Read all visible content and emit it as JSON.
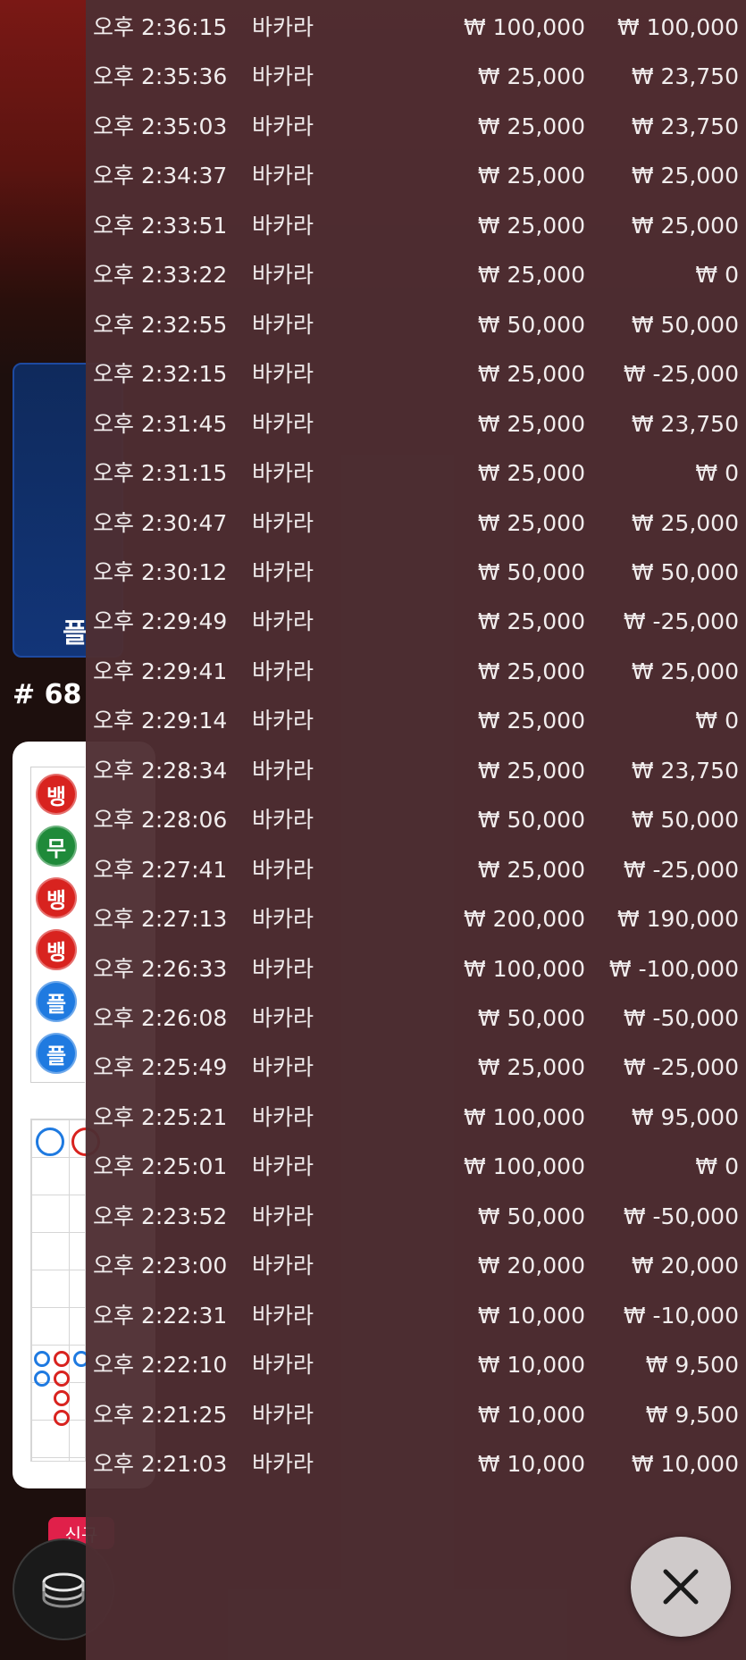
{
  "background": {
    "player_panel_label": "플",
    "round_number": "# 68",
    "bead_road": [
      {
        "label": "뱅",
        "color": "#d8231f"
      },
      {
        "label": "무",
        "color": "#1f8a3a"
      },
      {
        "label": "뱅",
        "color": "#d8231f"
      },
      {
        "label": "뱅",
        "color": "#d8231f"
      },
      {
        "label": "플",
        "color": "#1f7ae0"
      },
      {
        "label": "플",
        "color": "#1f7ae0"
      }
    ],
    "new_badge": "신규"
  },
  "history": {
    "rows": [
      {
        "time": "오후 2:36:15",
        "game": "바카라",
        "bet": "₩ 100,000",
        "payout": "₩ 100,000"
      },
      {
        "time": "오후 2:35:36",
        "game": "바카라",
        "bet": "₩ 25,000",
        "payout": "₩ 23,750"
      },
      {
        "time": "오후 2:35:03",
        "game": "바카라",
        "bet": "₩ 25,000",
        "payout": "₩ 23,750"
      },
      {
        "time": "오후 2:34:37",
        "game": "바카라",
        "bet": "₩ 25,000",
        "payout": "₩ 25,000"
      },
      {
        "time": "오후 2:33:51",
        "game": "바카라",
        "bet": "₩ 25,000",
        "payout": "₩ 25,000"
      },
      {
        "time": "오후 2:33:22",
        "game": "바카라",
        "bet": "₩ 25,000",
        "payout": "₩ 0"
      },
      {
        "time": "오후 2:32:55",
        "game": "바카라",
        "bet": "₩ 50,000",
        "payout": "₩ 50,000"
      },
      {
        "time": "오후 2:32:15",
        "game": "바카라",
        "bet": "₩ 25,000",
        "payout": "₩ -25,000"
      },
      {
        "time": "오후 2:31:45",
        "game": "바카라",
        "bet": "₩ 25,000",
        "payout": "₩ 23,750"
      },
      {
        "time": "오후 2:31:15",
        "game": "바카라",
        "bet": "₩ 25,000",
        "payout": "₩ 0"
      },
      {
        "time": "오후 2:30:47",
        "game": "바카라",
        "bet": "₩ 25,000",
        "payout": "₩ 25,000"
      },
      {
        "time": "오후 2:30:12",
        "game": "바카라",
        "bet": "₩ 50,000",
        "payout": "₩ 50,000"
      },
      {
        "time": "오후 2:29:49",
        "game": "바카라",
        "bet": "₩ 25,000",
        "payout": "₩ -25,000"
      },
      {
        "time": "오후 2:29:41",
        "game": "바카라",
        "bet": "₩ 25,000",
        "payout": "₩ 25,000"
      },
      {
        "time": "오후 2:29:14",
        "game": "바카라",
        "bet": "₩ 25,000",
        "payout": "₩ 0"
      },
      {
        "time": "오후 2:28:34",
        "game": "바카라",
        "bet": "₩ 25,000",
        "payout": "₩ 23,750"
      },
      {
        "time": "오후 2:28:06",
        "game": "바카라",
        "bet": "₩ 50,000",
        "payout": "₩ 50,000"
      },
      {
        "time": "오후 2:27:41",
        "game": "바카라",
        "bet": "₩ 25,000",
        "payout": "₩ -25,000"
      },
      {
        "time": "오후 2:27:13",
        "game": "바카라",
        "bet": "₩ 200,000",
        "payout": "₩ 190,000"
      },
      {
        "time": "오후 2:26:33",
        "game": "바카라",
        "bet": "₩ 100,000",
        "payout": "₩ -100,000"
      },
      {
        "time": "오후 2:26:08",
        "game": "바카라",
        "bet": "₩ 50,000",
        "payout": "₩ -50,000"
      },
      {
        "time": "오후 2:25:49",
        "game": "바카라",
        "bet": "₩ 25,000",
        "payout": "₩ -25,000"
      },
      {
        "time": "오후 2:25:21",
        "game": "바카라",
        "bet": "₩ 100,000",
        "payout": "₩ 95,000"
      },
      {
        "time": "오후 2:25:01",
        "game": "바카라",
        "bet": "₩ 100,000",
        "payout": "₩ 0"
      },
      {
        "time": "오후 2:23:52",
        "game": "바카라",
        "bet": "₩ 50,000",
        "payout": "₩ -50,000"
      },
      {
        "time": "오후 2:23:00",
        "game": "바카라",
        "bet": "₩ 20,000",
        "payout": "₩ 20,000"
      },
      {
        "time": "오후 2:22:31",
        "game": "바카라",
        "bet": "₩ 10,000",
        "payout": "₩ -10,000"
      },
      {
        "time": "오후 2:22:10",
        "game": "바카라",
        "bet": "₩ 10,000",
        "payout": "₩ 9,500"
      },
      {
        "time": "오후 2:21:25",
        "game": "바카라",
        "bet": "₩ 10,000",
        "payout": "₩ 9,500"
      },
      {
        "time": "오후 2:21:03",
        "game": "바카라",
        "bet": "₩ 10,000",
        "payout": "₩ 10,000"
      }
    ]
  },
  "close_button": {
    "icon": "close-icon"
  }
}
